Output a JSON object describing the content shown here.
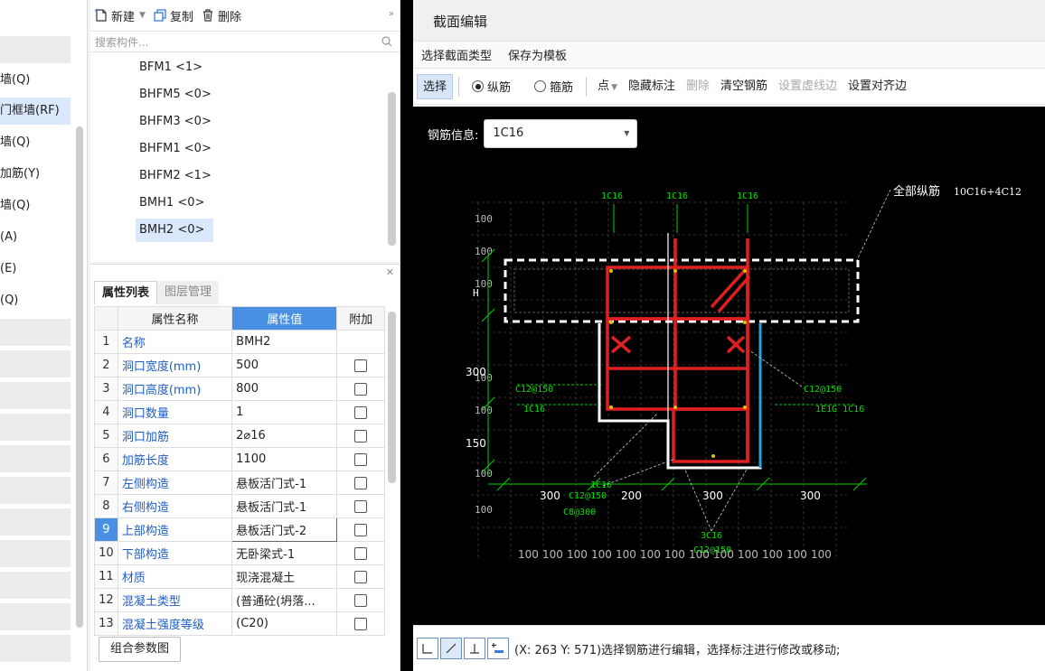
{
  "left_panel": {
    "items": [
      "墙(Q)",
      "门框墙(RF)",
      "墙(Q)",
      "加筋(Y)",
      "墙(Q)",
      "(A)",
      "(E)",
      "(Q)"
    ]
  },
  "component_panel": {
    "toolbar": {
      "new_label": "新建",
      "copy_label": "复制",
      "delete_label": "删除"
    },
    "search_placeholder": "搜索构件...",
    "items": [
      "BFM1 <1>",
      "BHFM5 <0>",
      "BHFM3 <0>",
      "BHFM1 <0>",
      "BHFM2 <1>",
      "BMH1 <0>",
      "BMH2 <0>"
    ]
  },
  "property_panel": {
    "tabs": [
      "属性列表",
      "图层管理"
    ],
    "headers": {
      "name": "属性名称",
      "value": "属性值",
      "extra": "附加"
    },
    "rows": [
      {
        "idx": "1",
        "name": "名称",
        "value": "BMH2"
      },
      {
        "idx": "2",
        "name": "洞口宽度(mm)",
        "value": "500"
      },
      {
        "idx": "3",
        "name": "洞口高度(mm)",
        "value": "800"
      },
      {
        "idx": "4",
        "name": "洞口数量",
        "value": "1"
      },
      {
        "idx": "5",
        "name": "洞口加筋",
        "value": "2⌀16"
      },
      {
        "idx": "6",
        "name": "加筋长度",
        "value": "1100"
      },
      {
        "idx": "7",
        "name": "左侧构造",
        "value": "悬板活门式-1"
      },
      {
        "idx": "8",
        "name": "右侧构造",
        "value": "悬板活门式-1"
      },
      {
        "idx": "9",
        "name": "上部构造",
        "value": "悬板活门式-2"
      },
      {
        "idx": "10",
        "name": "下部构造",
        "value": "无卧梁式-1"
      },
      {
        "idx": "11",
        "name": "材质",
        "value": "现浇混凝土"
      },
      {
        "idx": "12",
        "name": "混凝土类型",
        "value": "(普通砼(坍落..."
      },
      {
        "idx": "13",
        "name": "混凝土强度等级",
        "value": "(C20)"
      }
    ],
    "combo_button": "组合参数图"
  },
  "dialog": {
    "title": "截面编辑",
    "menu": [
      "选择截面类型",
      "保存为模板"
    ],
    "tools": {
      "select": "选择",
      "radio_longitudinal": "纵筋",
      "radio_stirrup": "箍筋",
      "point": "点",
      "hide_label": "隐藏标注",
      "delete": "删除",
      "clear_rebar": "清空钢筋",
      "set_dashed": "设置虚线边",
      "set_align": "设置对齐边"
    },
    "rebar_info_label": "钢筋信息:",
    "rebar_info_value": "1C16",
    "drawing": {
      "all_longitudinal_label": "全部纵筋",
      "all_longitudinal_value": "10C16+4C12",
      "top_labels": [
        "1C16",
        "1C16",
        "1C16"
      ],
      "left_dims": [
        "100",
        "100",
        "100",
        "100",
        "100",
        "100",
        "100"
      ],
      "vertical_dims": [
        "300",
        "150"
      ],
      "h_label": "H",
      "left_c12": "C12@150",
      "left_c16": "1C16",
      "right_c12": "C12@150",
      "right_c16": "1E1G 1C16",
      "bottom_dims": [
        "300",
        "200",
        "300",
        "300"
      ],
      "bottom_left_1": "1C16",
      "bottom_left_2": "C12@150",
      "bottom_left_3": "C8@300",
      "bottom_mid_1": "3C16",
      "bottom_mid_2": "C12@150",
      "grid_bottom": [
        "100",
        "100",
        "100",
        "100",
        "100",
        "100",
        "100",
        "100",
        "100",
        "100",
        "100",
        "100",
        "100"
      ]
    },
    "status_text": "(X: 263 Y: 571)选择钢筋进行编辑，选择标注进行修改或移动;"
  }
}
